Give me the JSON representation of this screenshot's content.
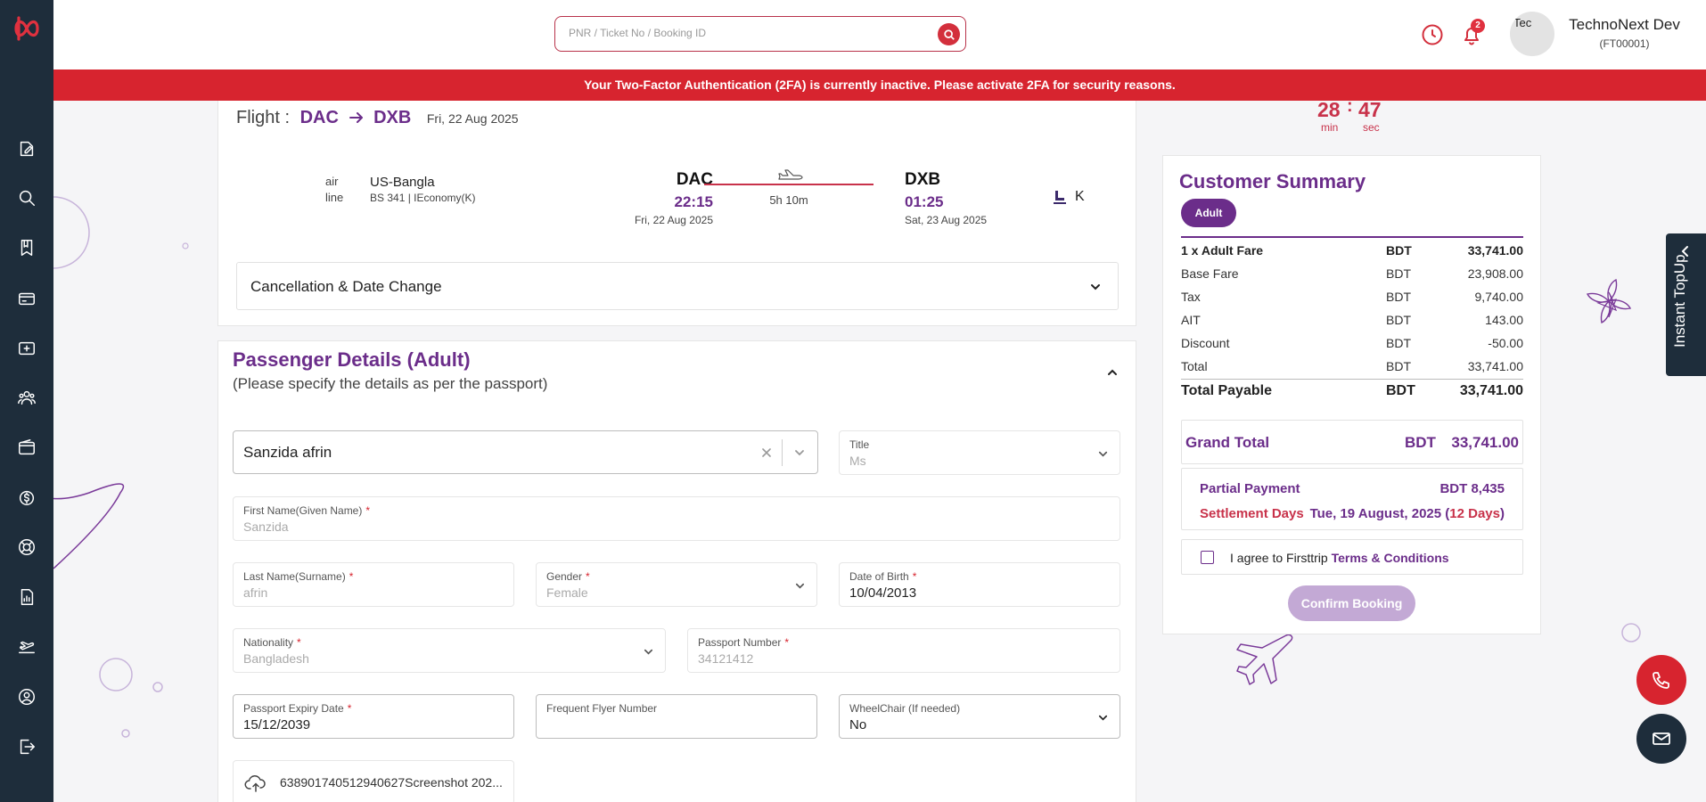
{
  "colors": {
    "brand_purple": "#6b2d8a",
    "brand_red": "#d7242f",
    "sidebar": "#1e2d3b",
    "accent_pink": "#c8324a"
  },
  "sidebar": {
    "items": [
      {
        "icon": "edit-document-icon"
      },
      {
        "icon": "search-icon"
      },
      {
        "icon": "bookmark-book-icon"
      },
      {
        "icon": "card-icon"
      },
      {
        "icon": "money-add-icon"
      },
      {
        "icon": "team-icon"
      },
      {
        "icon": "wallet-icon"
      },
      {
        "icon": "dollar-cycle-icon"
      },
      {
        "icon": "support-lifebuoy-icon"
      },
      {
        "icon": "report-chart-icon"
      },
      {
        "icon": "flight-takeoff-icon"
      },
      {
        "icon": "user-profile-icon"
      },
      {
        "icon": "logout-icon"
      }
    ]
  },
  "topbar": {
    "search_placeholder": "PNR / Ticket No / Booking ID",
    "notifications_count": "2",
    "avatar_alt": "Tec",
    "user_name": "TechnoNext Dev",
    "user_code": "(FT00001)"
  },
  "alert": {
    "message": "Your Two-Factor Authentication (2FA) is currently inactive. Please activate 2FA for security reasons."
  },
  "flight": {
    "label": "Flight :",
    "from": "DAC",
    "to": "DXB",
    "date": "Fri, 22 Aug 2025",
    "airline_logo_alt": "air line",
    "airline": "US-Bangla",
    "flight_info": "BS 341 | IEconomy(K)",
    "departure": {
      "code": "DAC",
      "time": "22:15",
      "date": "Fri, 22 Aug 2025"
    },
    "arrival": {
      "code": "DXB",
      "time": "01:25",
      "date": "Sat, 23 Aug 2025"
    },
    "duration": "5h 10m",
    "cabin_class": "K",
    "cancellation_label": "Cancellation & Date Change"
  },
  "passenger": {
    "title": "Passenger Details (Adult)",
    "subtitle": "(Please specify the details as per the passport)",
    "selected_traveller": "Sanzida afrin",
    "fields": {
      "title": {
        "label": "Title",
        "value": "Ms"
      },
      "first_name": {
        "label": "First Name(Given Name)",
        "value": "Sanzida"
      },
      "last_name": {
        "label": "Last Name(Surname)",
        "value": "afrin"
      },
      "gender": {
        "label": "Gender",
        "value": "Female"
      },
      "dob": {
        "label": "Date of Birth",
        "value": "10/04/2013"
      },
      "nationality": {
        "label": "Nationality",
        "value": "Bangladesh"
      },
      "passport_number": {
        "label": "Passport Number",
        "value": "34121412"
      },
      "passport_expiry": {
        "label": "Passport Expiry Date",
        "value": "15/12/2039"
      },
      "frequent_flyer": {
        "label": "Frequent Flyer Number",
        "value": ""
      },
      "wheelchair": {
        "label": "WheelChair (If needed)",
        "value": "No"
      }
    },
    "required_mark": "*",
    "upload_filename": "638901740512940627Screenshot 202..."
  },
  "timer": {
    "minutes": "28",
    "seconds": "47",
    "min_label": "min",
    "sec_label": "sec",
    "colon": ":"
  },
  "summary": {
    "title": "Customer Summary",
    "tab": "Adult",
    "rows": [
      {
        "label": "1 x Adult Fare",
        "currency": "BDT",
        "amount": "33,741.00"
      },
      {
        "label": "Base Fare",
        "currency": "BDT",
        "amount": "23,908.00"
      },
      {
        "label": "Tax",
        "currency": "BDT",
        "amount": "9,740.00"
      },
      {
        "label": "AIT",
        "currency": "BDT",
        "amount": "143.00"
      },
      {
        "label": "Discount",
        "currency": "BDT",
        "amount": "-50.00"
      },
      {
        "label": "Total",
        "currency": "BDT",
        "amount": "33,741.00"
      }
    ],
    "total_payable": {
      "label": "Total Payable",
      "currency": "BDT",
      "amount": "33,741.00"
    },
    "grand_total": {
      "label": "Grand Total",
      "currency": "BDT",
      "amount": "33,741.00"
    },
    "partial_payment": {
      "label": "Partial Payment",
      "value": "BDT 8,435"
    },
    "settlement": {
      "label": "Settlement Days",
      "date": "Tue, 19 August, 2025 (",
      "days": "12 Days",
      "close": ")"
    },
    "agree_text": "I agree to Firsttrip ",
    "terms_link": "Terms & Conditions",
    "confirm_label": "Confirm Booking"
  },
  "topup": {
    "label": "Instant TopUp"
  }
}
